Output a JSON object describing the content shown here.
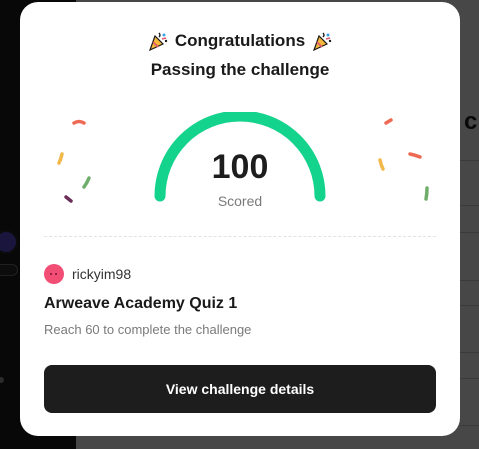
{
  "modal": {
    "title": "Congratulations",
    "subtitle": "Passing the challenge",
    "score": {
      "value": "100",
      "label": "Scored",
      "percent": 100
    },
    "user": {
      "name": "rickyim98"
    },
    "quiz_title": "Arweave Academy Quiz 1",
    "requirement": "Reach 60 to complete the challenge",
    "details_button_label": "View challenge details"
  },
  "colors": {
    "gauge": "#14d38c",
    "button_bg": "#1d1d1d",
    "avatar": "#f24d75",
    "confetti_red": "#ef6a55",
    "confetti_yellow": "#f2b84b",
    "confetti_green": "#6fae6a",
    "confetti_purple": "#6b2f59"
  },
  "icons": {
    "title_left": "party-popper-icon",
    "title_right": "party-popper-icon"
  }
}
